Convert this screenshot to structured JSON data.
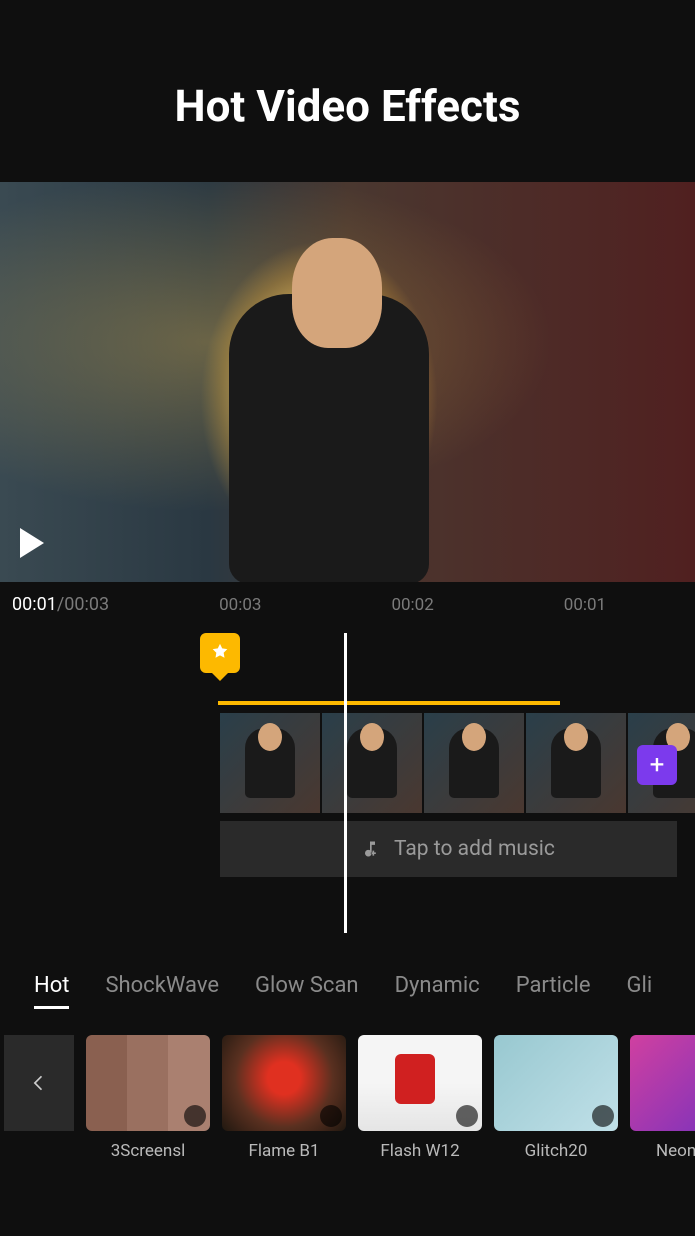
{
  "header": {
    "title": "Hot Video Effects"
  },
  "timeline": {
    "current_time": "00:01",
    "total_time": "/00:03",
    "ticks": [
      "00:03",
      "00:02",
      "00:01"
    ],
    "add_music_label": "Tap to add music",
    "add_button": "+"
  },
  "categories": [
    {
      "label": "Hot",
      "active": true
    },
    {
      "label": "ShockWave",
      "active": false
    },
    {
      "label": "Glow Scan",
      "active": false
    },
    {
      "label": "Dynamic",
      "active": false
    },
    {
      "label": "Particle",
      "active": false
    },
    {
      "label": "Gli",
      "active": false
    }
  ],
  "effects": [
    {
      "label": "3Screensl",
      "thumbClass": "th-3screens"
    },
    {
      "label": "Flame B1",
      "thumbClass": "th-flame"
    },
    {
      "label": "Flash W12",
      "thumbClass": "th-flash"
    },
    {
      "label": "Glitch20",
      "thumbClass": "th-glitch"
    },
    {
      "label": "NeonLine",
      "thumbClass": "th-neon"
    }
  ]
}
